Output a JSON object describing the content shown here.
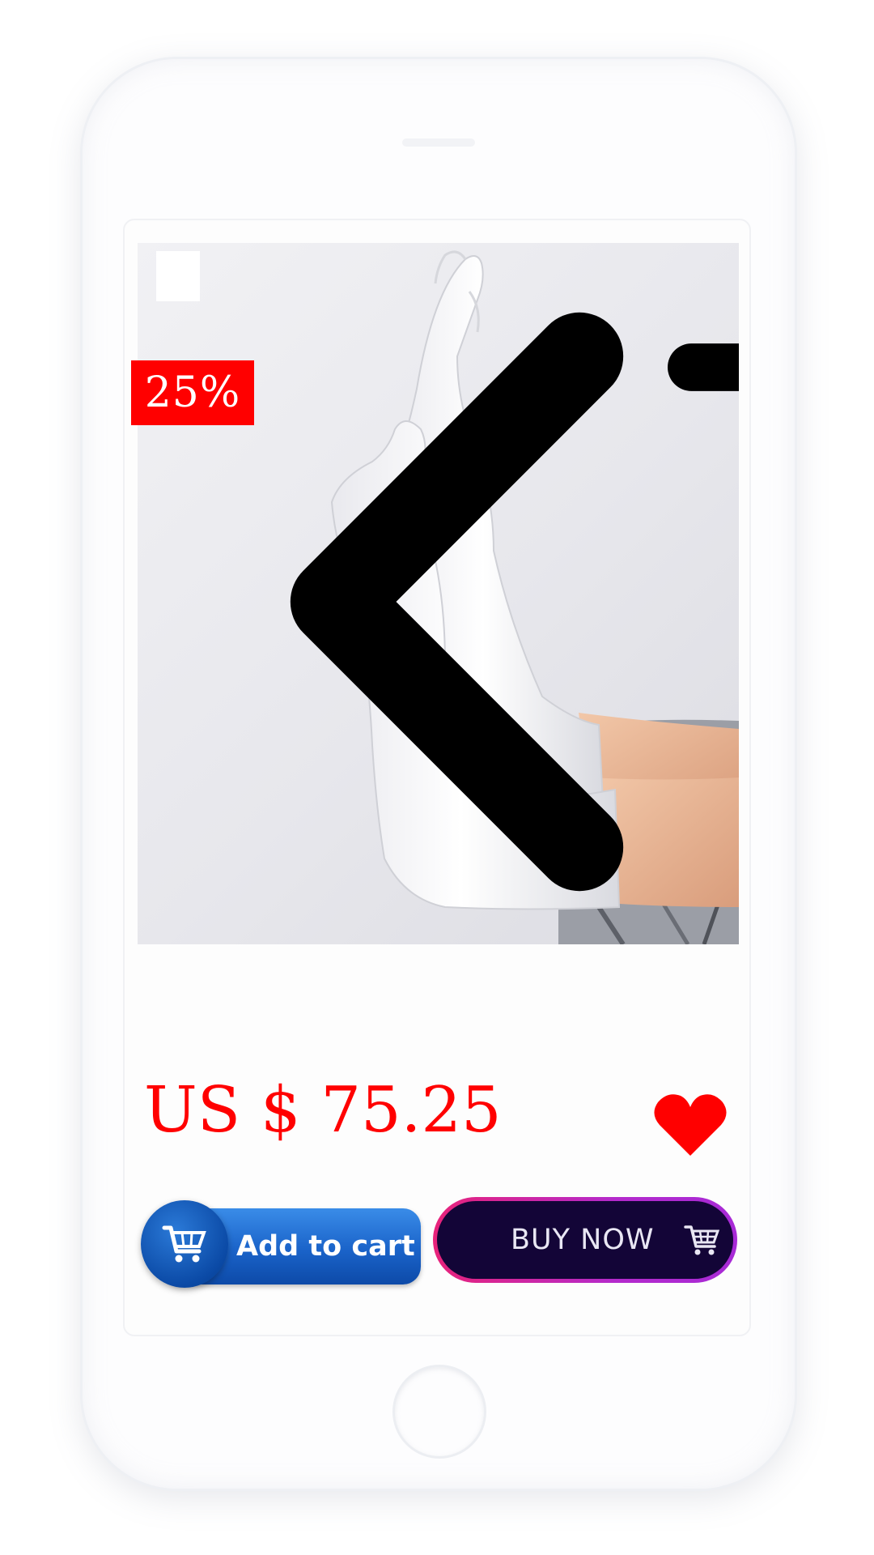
{
  "product": {
    "discount_badge": "25%",
    "price": "US $ 75.25"
  },
  "actions": {
    "add_to_cart_label": "Add to cart",
    "buy_now_label": "BUY NOW"
  },
  "icons": {
    "back": "chevron-left-icon",
    "cart": "shopping-cart-icon",
    "wishlist": "heart-icon",
    "add_to_cart": "cart-icon",
    "buy_now": "cart-icon"
  },
  "colors": {
    "price": "#ff0000",
    "badge_bg": "#ff0000",
    "wishlist": "#ff0000",
    "add_to_cart_bg": "#1a63c9",
    "buy_now_bg": "#130537",
    "buy_now_border": "#c02aa8",
    "cart_top_fill": "#f5a623"
  }
}
